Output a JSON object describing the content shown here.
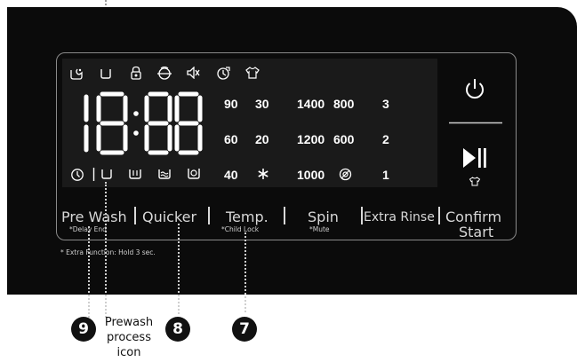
{
  "display": {
    "time_digits": "18:88",
    "temperature_values": [
      "90",
      "60",
      "40"
    ],
    "temperature_values_right": [
      "30",
      "20"
    ],
    "spin_values_left": [
      "1400",
      "1200",
      "1000"
    ],
    "spin_values_right": [
      "800",
      "600"
    ],
    "rinse_values": [
      "3",
      "2",
      "1"
    ]
  },
  "buttons": {
    "pre_wash": "Pre Wash",
    "pre_wash_sub": "*Delay End",
    "quicker": "Quicker",
    "temp": "Temp.",
    "temp_sub": "*Child Lock",
    "spin": "Spin",
    "spin_sub": "*Mute",
    "extra_rinse": "Extra Rinse",
    "confirm": "Confirm",
    "start": "Start"
  },
  "footnote": "* Extra Function: Hold 3 sec.",
  "callouts": {
    "c9": "9",
    "c8": "8",
    "c7": "7",
    "caption_line1": "Prewash",
    "caption_line2": "process",
    "caption_line3": "icon"
  },
  "icons": [
    "stain-icon",
    "prewash-tub-icon",
    "lock-icon",
    "drum-clean-icon",
    "mute-icon",
    "delay-timer-icon",
    "shirt-icon",
    "clock-icon",
    "wash-tub-icon",
    "main-wash-tub-icon",
    "rinse-icon",
    "spin-icon",
    "snowflake-icon",
    "no-spin-icon",
    "power-icon",
    "play-pause-icon",
    "extra-rinse-shirt-icon"
  ]
}
